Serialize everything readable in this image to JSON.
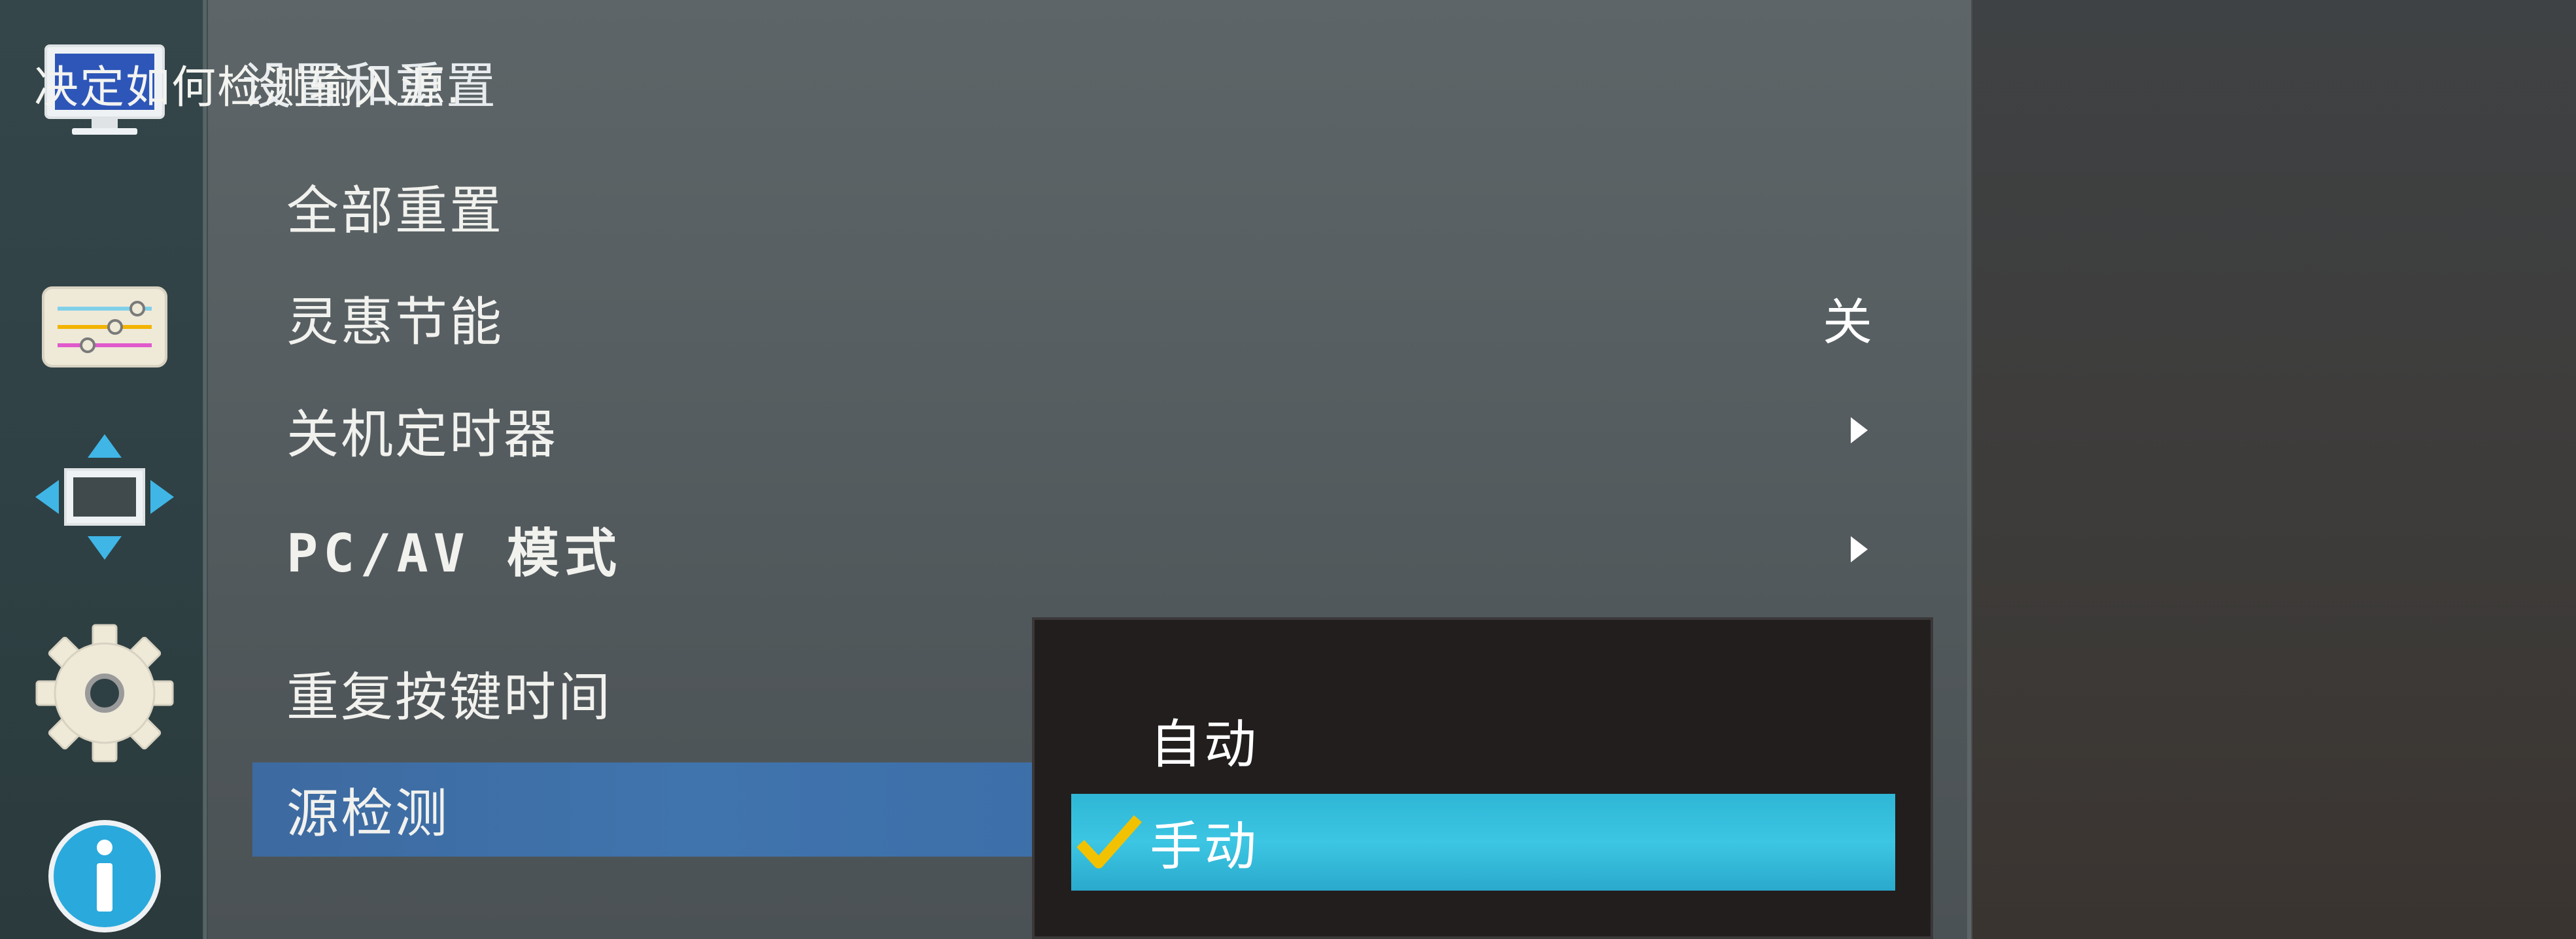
{
  "menu": {
    "title": "设置和重置",
    "items": [
      {
        "label": "全部重置",
        "value": "",
        "submenu": false
      },
      {
        "label": "灵惠节能",
        "value": "关",
        "submenu": false
      },
      {
        "label": "关机定时器",
        "value": "",
        "submenu": true
      },
      {
        "label": "PC/AV 模式",
        "value": "",
        "submenu": true
      },
      {
        "label": "重复按键时间",
        "value": "",
        "submenu": false
      },
      {
        "label": "源检测",
        "value": "",
        "submenu": false,
        "selected": true
      }
    ]
  },
  "popup": {
    "options": [
      {
        "label": "自动",
        "checked": false
      },
      {
        "label": "手动",
        "checked": true
      }
    ]
  },
  "help": {
    "text": "决定如何检测输入源."
  },
  "sidebar": {
    "icons": [
      "monitor-icon",
      "picture-adjust-icon",
      "position-icon",
      "gear-icon",
      "info-icon"
    ]
  },
  "colors": {
    "selected_item": "#4074ad",
    "popup_highlight": "#3cc6e3",
    "check": "#f2c200"
  }
}
